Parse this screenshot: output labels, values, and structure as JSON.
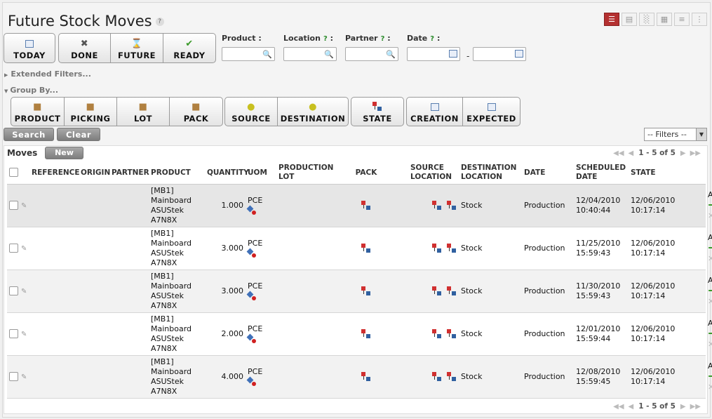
{
  "header": {
    "title": "Future Stock Moves",
    "help": "?",
    "view_modes": [
      "list-icon",
      "page-icon",
      "graph-icon",
      "calendar-icon",
      "gantt-icon",
      "grid-icon"
    ]
  },
  "state_filters": [
    {
      "label": "TODAY",
      "icon": "calendar-icon"
    },
    {
      "label": "DONE",
      "icon": "cross-icon"
    },
    {
      "label": "FUTURE",
      "icon": "hourglass-icon"
    },
    {
      "label": "READY",
      "icon": "check-icon"
    }
  ],
  "search_fields": {
    "product_label": "Product :",
    "location_label": "Location",
    "partner_label": "Partner",
    "date_label": "Date",
    "help_mark": "?",
    "colon": ":",
    "product_value": "",
    "location_value": "",
    "partner_value": "",
    "date_from": "",
    "date_to": "",
    "date_separator": "-"
  },
  "extended_filters": "Extended Filters...",
  "group_by": {
    "label": "Group By...",
    "groups": [
      [
        {
          "label": "PRODUCT",
          "icon": "box-icon"
        },
        {
          "label": "PICKING",
          "icon": "box-icon"
        },
        {
          "label": "LOT",
          "icon": "box-icon"
        },
        {
          "label": "PACK",
          "icon": "box-icon"
        }
      ],
      [
        {
          "label": "SOURCE",
          "icon": "source-icon"
        },
        {
          "label": "DESTINATION",
          "icon": "destination-icon"
        }
      ],
      [
        {
          "label": "STATE",
          "icon": "state-icon"
        }
      ],
      [
        {
          "label": "CREATION",
          "icon": "calendar-icon"
        },
        {
          "label": "EXPECTED",
          "icon": "calendar-icon"
        }
      ]
    ]
  },
  "actions": {
    "search": "Search",
    "clear": "Clear",
    "filters_select": "-- Filters --"
  },
  "list": {
    "title": "Moves",
    "new_button": "New",
    "pager": "1 - 5 of 5",
    "columns": [
      "REFERENCE",
      "ORIGIN",
      "PARTNER",
      "PRODUCT",
      "QUANTITY",
      "UOM",
      "PRODUCTION LOT",
      "PACK",
      "SOURCE LOCATION",
      "DESTINATION LOCATION",
      "DATE",
      "SCHEDULED DATE",
      "STATE"
    ],
    "rows": [
      {
        "product": [
          "[MB1]",
          "Mainboard",
          "ASUStek",
          "A7N8X"
        ],
        "quantity": "1.000",
        "uom": "PCE",
        "source": "Stock",
        "destination": "Production",
        "date": [
          "12/04/2010",
          "10:40:44"
        ],
        "scheduled": [
          "12/06/2010",
          "10:17:14"
        ],
        "state": "Available"
      },
      {
        "product": [
          "[MB1]",
          "Mainboard",
          "ASUStek",
          "A7N8X"
        ],
        "quantity": "3.000",
        "uom": "PCE",
        "source": "Stock",
        "destination": "Production",
        "date": [
          "11/25/2010",
          "15:59:43"
        ],
        "scheduled": [
          "12/06/2010",
          "10:17:14"
        ],
        "state": "Available"
      },
      {
        "product": [
          "[MB1]",
          "Mainboard",
          "ASUStek",
          "A7N8X"
        ],
        "quantity": "3.000",
        "uom": "PCE",
        "source": "Stock",
        "destination": "Production",
        "date": [
          "11/30/2010",
          "15:59:43"
        ],
        "scheduled": [
          "12/06/2010",
          "10:17:14"
        ],
        "state": "Available"
      },
      {
        "product": [
          "[MB1]",
          "Mainboard",
          "ASUStek",
          "A7N8X"
        ],
        "quantity": "2.000",
        "uom": "PCE",
        "source": "Stock",
        "destination": "Production",
        "date": [
          "12/01/2010",
          "15:59:44"
        ],
        "scheduled": [
          "12/06/2010",
          "10:17:14"
        ],
        "state": "Available"
      },
      {
        "product": [
          "[MB1]",
          "Mainboard",
          "ASUStek",
          "A7N8X"
        ],
        "quantity": "4.000",
        "uom": "PCE",
        "source": "Stock",
        "destination": "Production",
        "date": [
          "12/08/2010",
          "15:59:45"
        ],
        "scheduled": [
          "12/06/2010",
          "10:17:14"
        ],
        "state": "Available"
      }
    ]
  }
}
